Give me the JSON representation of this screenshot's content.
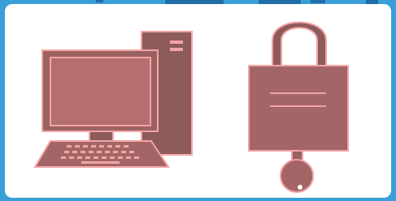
{
  "colors": {
    "background": "#3a9fd8",
    "card": "#ffffff",
    "icon_fill": "#a36565",
    "icon_fill_dark": "#8e5b5b",
    "icon_outline": "#f3a4a6",
    "screen_fill": "#b56f70",
    "key_fill": "#f39fa4"
  },
  "icons": {
    "computer": "desktop-computer-icon",
    "lock": "padlock-icon",
    "key": "key-icon"
  }
}
